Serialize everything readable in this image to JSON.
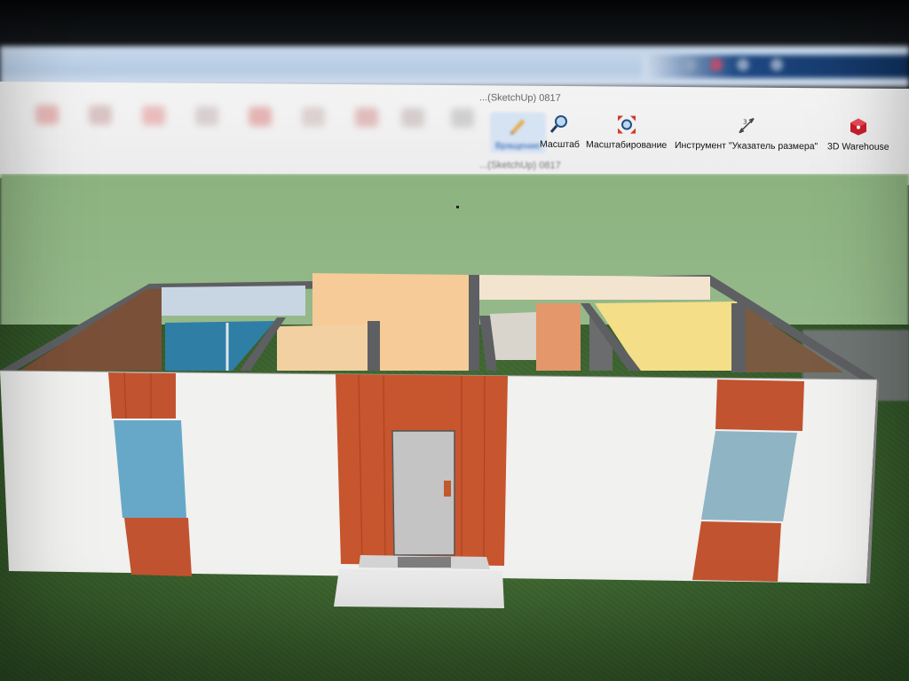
{
  "window": {
    "filename_top": "...(SketchUp) 0817",
    "filename_bottom": "...(SketchUp) 0817"
  },
  "toolbar": {
    "tools": [
      {
        "id": "orbit",
        "label": "Вращение",
        "icon": "orbit-pencil-icon",
        "active": true
      },
      {
        "id": "zoom",
        "label": "Масштаб",
        "icon": "magnifier-icon",
        "active": false
      },
      {
        "id": "zoom_extents",
        "label": "Масштабирование",
        "icon": "zoom-extents-icon",
        "active": false
      },
      {
        "id": "dimension",
        "label": "Инструмент \"Указатель размера\"",
        "icon": "dimension-tool-icon",
        "active": false
      },
      {
        "id": "warehouse",
        "label": "3D Warehouse",
        "icon": "warehouse-icon",
        "active": false
      }
    ]
  },
  "colors": {
    "accent": "#2a62b0",
    "wall_exterior": "#f2f2f0",
    "wood_cladding": "#c0512c",
    "interior_peach": "#f5cf9f",
    "interior_yellow": "#f3de8a",
    "glass": "#5da9c9",
    "ground": "#3f6a31",
    "sky": "#93b888"
  }
}
